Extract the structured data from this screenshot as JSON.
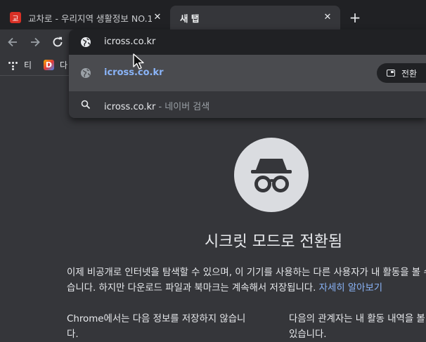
{
  "tabs": [
    {
      "title": "교차로 - 우리지역 생활정보 NO.1",
      "favicon_char": "교",
      "active": false
    },
    {
      "title": "새 탭",
      "active": true
    }
  ],
  "tab_close_glyph": "✕",
  "new_tab_glyph": "+",
  "bookmarks": [
    {
      "label": "티",
      "icon": "dots-grid-icon"
    },
    {
      "label": "다",
      "icon_char": "D",
      "icon": "daum-icon"
    }
  ],
  "omnibox": {
    "input_text": "icross.co.kr",
    "selected_suggestion": "icross.co.kr",
    "switch_label": "전환",
    "search_suggestion": "icross.co.kr",
    "search_hint": " - 네이버 검색"
  },
  "page": {
    "headline": "시크릿 모드로 전환됨",
    "para_line1": "이제 비공개로 인터넷을 탐색할 수 있으며, 이 기기를 사용하는 다른 사용자가 내 활동을 볼 수 없",
    "para_line2": "습니다. 하지만 다운로드 파일과 북마크는 계속해서 저장됩니다. ",
    "learn_more": "자세히 알아보기",
    "col1_line1": "Chrome에서는 다음 정보를 저장하지 않습니",
    "col1_line2": "다.",
    "col2_line1": "다음의 관계자는 내 활동 내역을 볼 수",
    "col2_line2": "있습니다."
  },
  "colors": {
    "tabstrip": "#202124",
    "toolbar": "#35363a",
    "link": "#8ab4f8",
    "favicon": "#d93025"
  }
}
